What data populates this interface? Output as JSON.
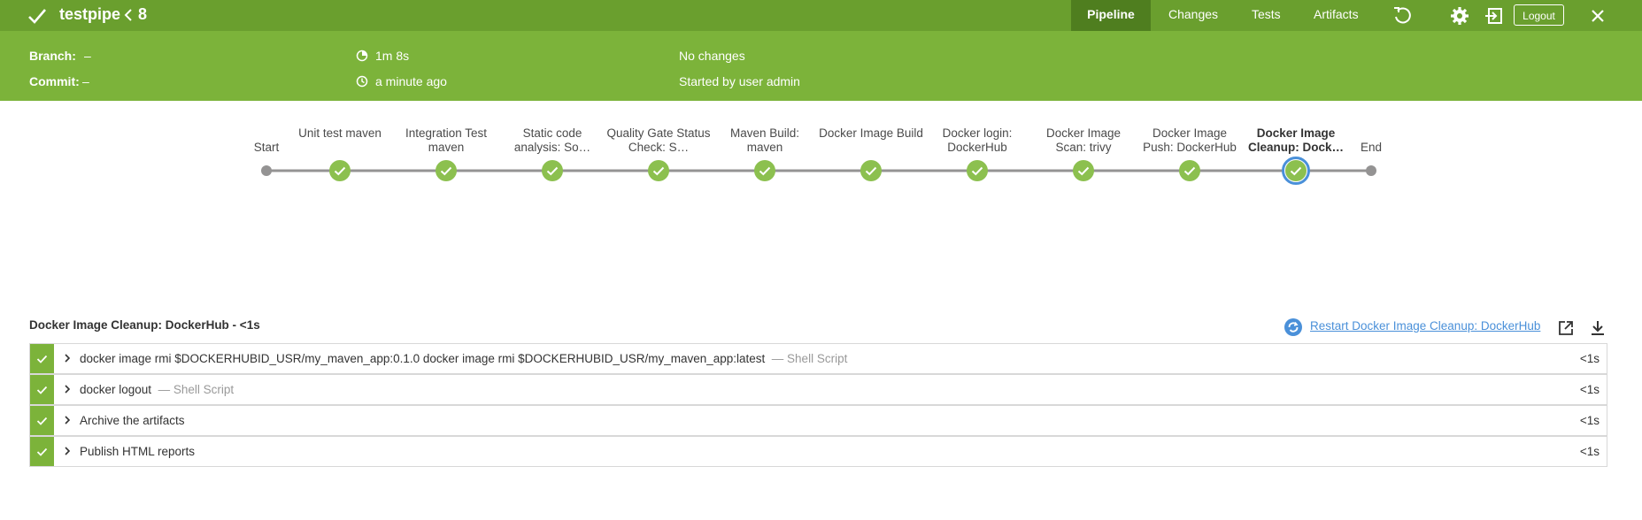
{
  "header": {
    "pipeline_name": "testpipe",
    "run_number": "8",
    "tabs": [
      "Pipeline",
      "Changes",
      "Tests",
      "Artifacts"
    ],
    "logout_label": "Logout",
    "accent_color": "#6a9f2e"
  },
  "summary": {
    "branch_label": "Branch:",
    "branch_value": "–",
    "commit_label": "Commit:",
    "commit_value": "–",
    "duration": "1m 8s",
    "time_ago": "a minute ago",
    "changes": "No changes",
    "started_by": "Started by user admin"
  },
  "stages": [
    {
      "label": "Start",
      "status": "node"
    },
    {
      "label": "Unit test maven",
      "status": "success"
    },
    {
      "label": "Integration Test maven",
      "status": "success"
    },
    {
      "label": "Static code analysis: So…",
      "status": "success"
    },
    {
      "label": "Quality Gate Status Check: S…",
      "status": "success"
    },
    {
      "label": "Maven Build: maven",
      "status": "success"
    },
    {
      "label": "Docker Image Build",
      "status": "success"
    },
    {
      "label": "Docker login: DockerHub",
      "status": "success"
    },
    {
      "label": "Docker Image Scan: trivy",
      "status": "success"
    },
    {
      "label": "Docker Image Push: DockerHub",
      "status": "success"
    },
    {
      "label": "Docker Image Cleanup: Dock…",
      "status": "selected"
    },
    {
      "label": "End",
      "status": "node"
    }
  ],
  "log": {
    "title": "Docker Image Cleanup: DockerHub - <1s",
    "restart_label": "Restart Docker Image Cleanup: DockerHub",
    "steps": [
      {
        "text": "docker image rmi $DOCKERHUBID_USR/my_maven_app:0.1.0 docker image rmi $DOCKERHUBID_USR/my_maven_app:latest",
        "type": "— Shell Script",
        "duration": "<1s"
      },
      {
        "text": "docker logout",
        "type": "— Shell Script",
        "duration": "<1s"
      },
      {
        "text": "Archive the artifacts",
        "type": "",
        "duration": "<1s"
      },
      {
        "text": "Publish HTML reports",
        "type": "",
        "duration": "<1s"
      }
    ]
  }
}
